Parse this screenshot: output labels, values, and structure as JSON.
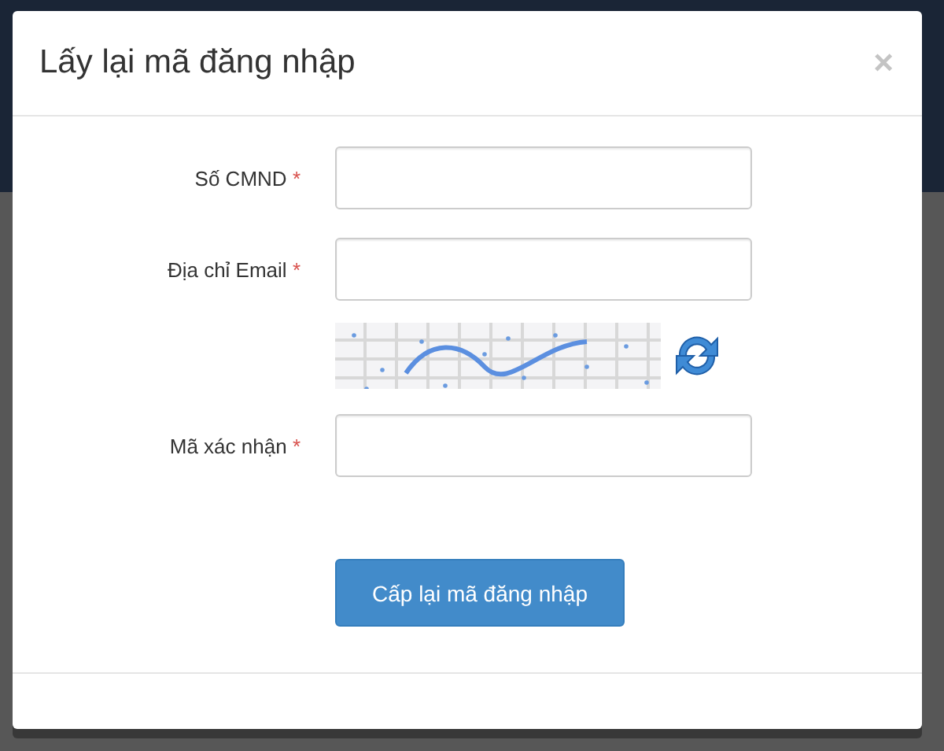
{
  "dialog": {
    "title": "Lấy lại mã đăng nhập",
    "close": "×"
  },
  "fields": [
    {
      "kind": "input",
      "label": "Số CMND",
      "required_mark": "*"
    },
    {
      "kind": "input",
      "label": "Địa chỉ Email",
      "required_mark": "*"
    },
    {
      "kind": "captcha"
    },
    {
      "kind": "input",
      "label": "Mã xác nhận",
      "required_mark": "*"
    }
  ],
  "submit": "Cấp lại mã đăng nhập"
}
